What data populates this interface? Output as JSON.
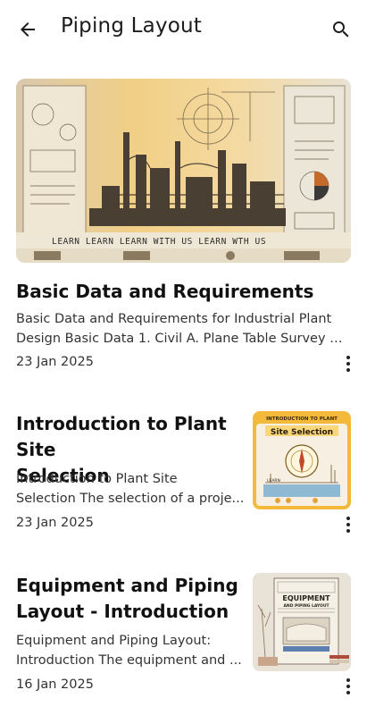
{
  "appbar": {
    "title": "Piping Layout",
    "back_icon": "arrow-back-icon",
    "search_icon": "search-icon"
  },
  "articles": [
    {
      "title": "Basic Data and Requirements",
      "excerpt_line1": "Basic Data and Requirements for Industrial Plant",
      "excerpt_line2": "Design Basic Data 1. Civil A. Plane Table Survey M...",
      "date": "23 Jan 2025",
      "image_text": "LEARN   LEARN   LEARN WITH US  LEARN    WTH US"
    },
    {
      "title_line1": "Introduction to Plant Site",
      "title_line2": "Selection",
      "excerpt_line1": "Introduction to Plant Site",
      "excerpt_line2": "Selection The selection of a proje...",
      "date": "23 Jan 2025",
      "thumb_caption_top": "INTRODUCTION TO PLANT",
      "thumb_caption_main": "Site Selection",
      "thumb_caption_bottom": "LEARN"
    },
    {
      "title_line1": "Equipment and Piping",
      "title_line2": "Layout - Introduction",
      "excerpt_line1": "Equipment and Piping Layout:",
      "excerpt_line2": "Introduction The equipment and ...",
      "date": "16 Jan 2025",
      "thumb_caption_main": "EQUIPMENT",
      "thumb_caption_sub": "AND PIPING LAYOUT"
    }
  ],
  "colors": {
    "accent_yellow": "#f2c14e",
    "sepia": "#c8b79a",
    "text_dark": "#111111"
  }
}
